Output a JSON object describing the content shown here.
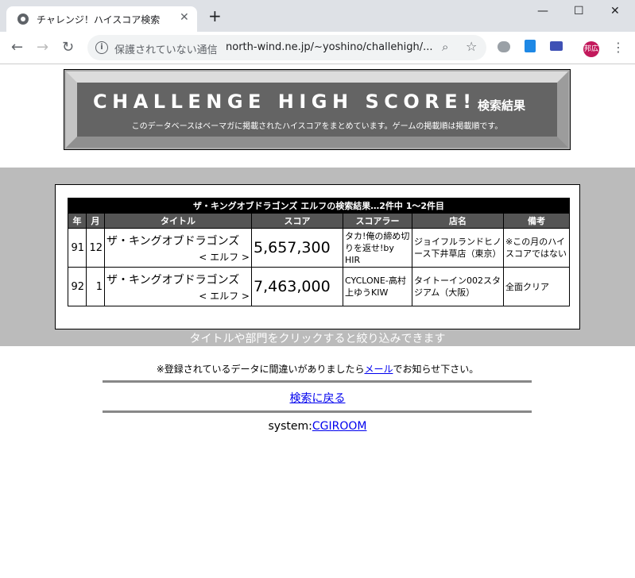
{
  "browser": {
    "tab_title": "チャレンジ！ハイスコア検索",
    "tab_close": "✕",
    "new_tab": "+",
    "win_min": "—",
    "win_max": "☐",
    "win_close": "✕",
    "insecure_label": "保護されていない通信",
    "url": "north-wind.ne.jp/~yoshino/challehigh/...",
    "profile_label": "邦広"
  },
  "banner": {
    "title": "CHALLENGE HIGH SCORE!",
    "suffix": "検索結果",
    "description": "このデータベースはベーマガに掲載されたハイスコアをまとめています。ゲームの掲載順は掲載順です。"
  },
  "results": {
    "caption": "ザ・キングオブドラゴンズ エルフの検索結果…2件中 1～2件目",
    "headers": [
      "年",
      "月",
      "タイトル",
      "スコア",
      "スコアラー",
      "店名",
      "備考"
    ],
    "rows": [
      {
        "year": "91",
        "month": "12",
        "title": "ザ・キングオブドラゴンズ",
        "subtitle": "< エルフ >",
        "score": "5,657,300",
        "scorer": "タカ!俺の締め切りを返せ!by HIR",
        "shop": "ジョイフルランドヒノース下井草店（東京）",
        "note": "※この月のハイスコアではない"
      },
      {
        "year": "92",
        "month": "1",
        "title": "ザ・キングオブドラゴンズ",
        "subtitle": "< エルフ >",
        "score": "7,463,000",
        "scorer": "CYCLONE-高村上ゆうKIW",
        "shop": "タイトーイン002スタジアム（大阪）",
        "note": "全面クリア"
      }
    ]
  },
  "hint": "タイトルや部門をクリックすると絞り込みできます",
  "notice": {
    "before": "※登録されているデータに間違いがありましたら",
    "link": "メール",
    "after": "でお知らせ下さい。"
  },
  "back_link": "検索に戻る",
  "system": {
    "label": "system:",
    "link": "CGIROOM"
  }
}
